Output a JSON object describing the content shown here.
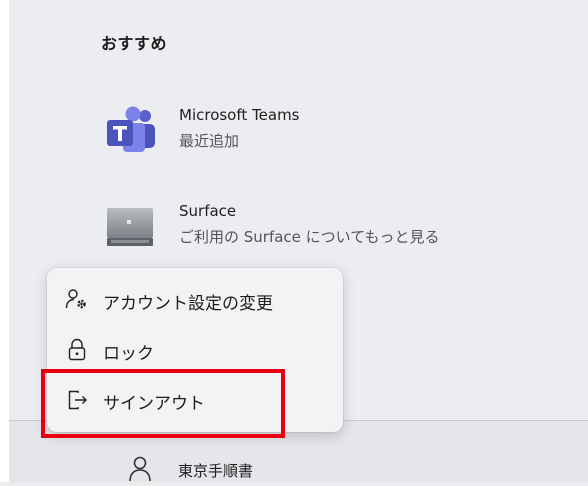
{
  "start_menu": {
    "section_title": "おすすめ",
    "recommended": [
      {
        "name": "Microsoft Teams",
        "subtitle": "最近追加",
        "icon": "teams-icon"
      },
      {
        "name": "Surface",
        "subtitle": "ご利用の Surface についてもっと見る",
        "icon": "surface-icon"
      }
    ],
    "user": {
      "name": "東京手順書",
      "icon": "user-icon"
    }
  },
  "account_menu": {
    "items": [
      {
        "label": "アカウント設定の変更",
        "icon": "account-settings-icon"
      },
      {
        "label": "ロック",
        "icon": "lock-icon"
      },
      {
        "label": "サインアウト",
        "icon": "sign-out-icon"
      }
    ]
  },
  "colors": {
    "highlight_border": "#e60012",
    "teams_brand": "#5059c9"
  }
}
